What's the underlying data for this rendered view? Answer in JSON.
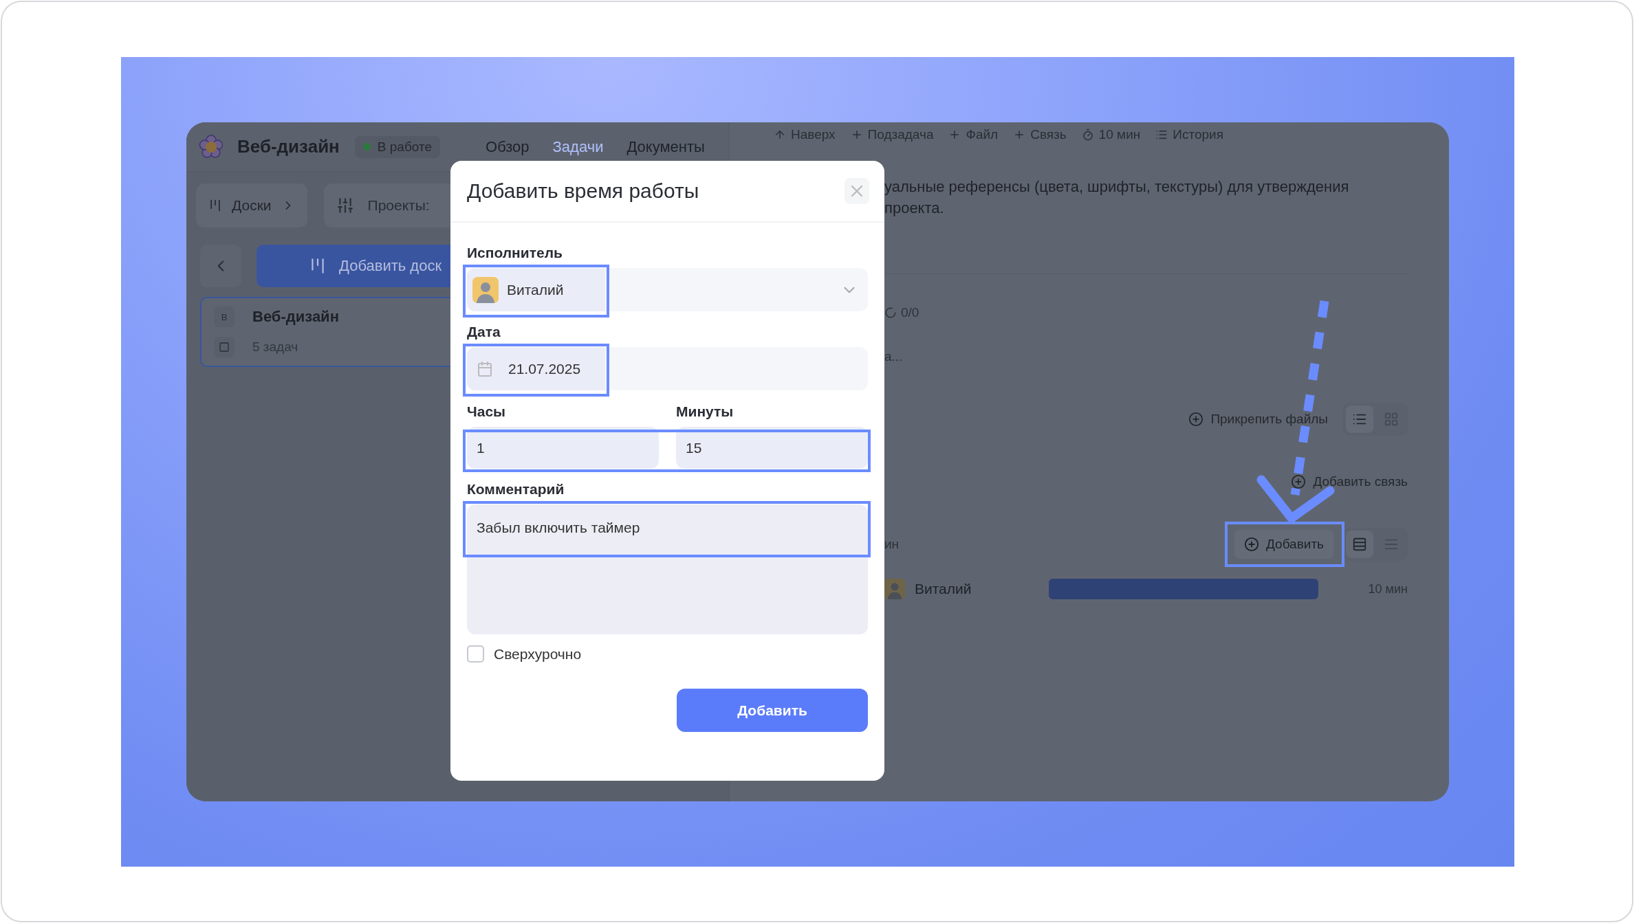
{
  "app": {
    "header": {
      "title": "Веб-дизайн",
      "status": {
        "label": "В работе",
        "color": "#2b7a3e"
      },
      "tabs": [
        {
          "label": "Обзор",
          "selected": false
        },
        {
          "label": "Задачи",
          "selected": true
        },
        {
          "label": "Документы",
          "selected": false
        }
      ]
    },
    "sidebar_toolbar": {
      "boards_button": "Доски",
      "projects_filter": "Проекты:"
    },
    "add_board_button": "Добавить доск",
    "boards": [
      {
        "badge": "В",
        "name": "Веб-дизайн",
        "count": "5 задач",
        "selected": true
      }
    ],
    "task_toolbar": [
      {
        "kind": "up",
        "label": "Наверх"
      },
      {
        "kind": "add",
        "label": "Подзадача"
      },
      {
        "kind": "add",
        "label": "Файл"
      },
      {
        "kind": "add",
        "label": "Связь"
      },
      {
        "kind": "timer",
        "label": "10 мин"
      },
      {
        "kind": "history",
        "label": "История"
      }
    ],
    "description_lines": [
      "уальные референсы (цвета, шрифты, текстуры) для утверждения",
      "проекта."
    ],
    "checklist_progress": "0/0",
    "truncated_text": "а...",
    "attach_files_button": "Прикрепить файлы",
    "file_view_toggle": [
      {
        "kind": "list",
        "selected": true
      },
      {
        "kind": "grid",
        "selected": false
      }
    ],
    "add_link_button": "Добавить связь",
    "time_section": {
      "label": "ин",
      "add_button": {
        "label": "Добавить",
        "highlighted": true
      },
      "view_toggle": [
        {
          "kind": "bars",
          "selected": true
        },
        {
          "kind": "list",
          "selected": false
        }
      ],
      "entries": [
        {
          "name": "Виталий",
          "duration": "10 мин"
        }
      ]
    }
  },
  "dialog": {
    "title": "Добавить время работы",
    "assignee": {
      "label": "Исполнитель",
      "value": "Виталий",
      "highlighted": true
    },
    "date": {
      "label": "Дата",
      "value": "21.07.2025",
      "highlighted": true
    },
    "duration": {
      "highlighted": true,
      "hours": {
        "label": "Часы",
        "value": "1"
      },
      "minutes": {
        "label": "Минуты",
        "value": "15"
      }
    },
    "comment": {
      "label": "Комментарий",
      "value": "Забыл включить таймер",
      "highlighted": true
    },
    "overtime": {
      "label": "Сверхурочно",
      "checked": false
    },
    "submit": "Добавить"
  }
}
